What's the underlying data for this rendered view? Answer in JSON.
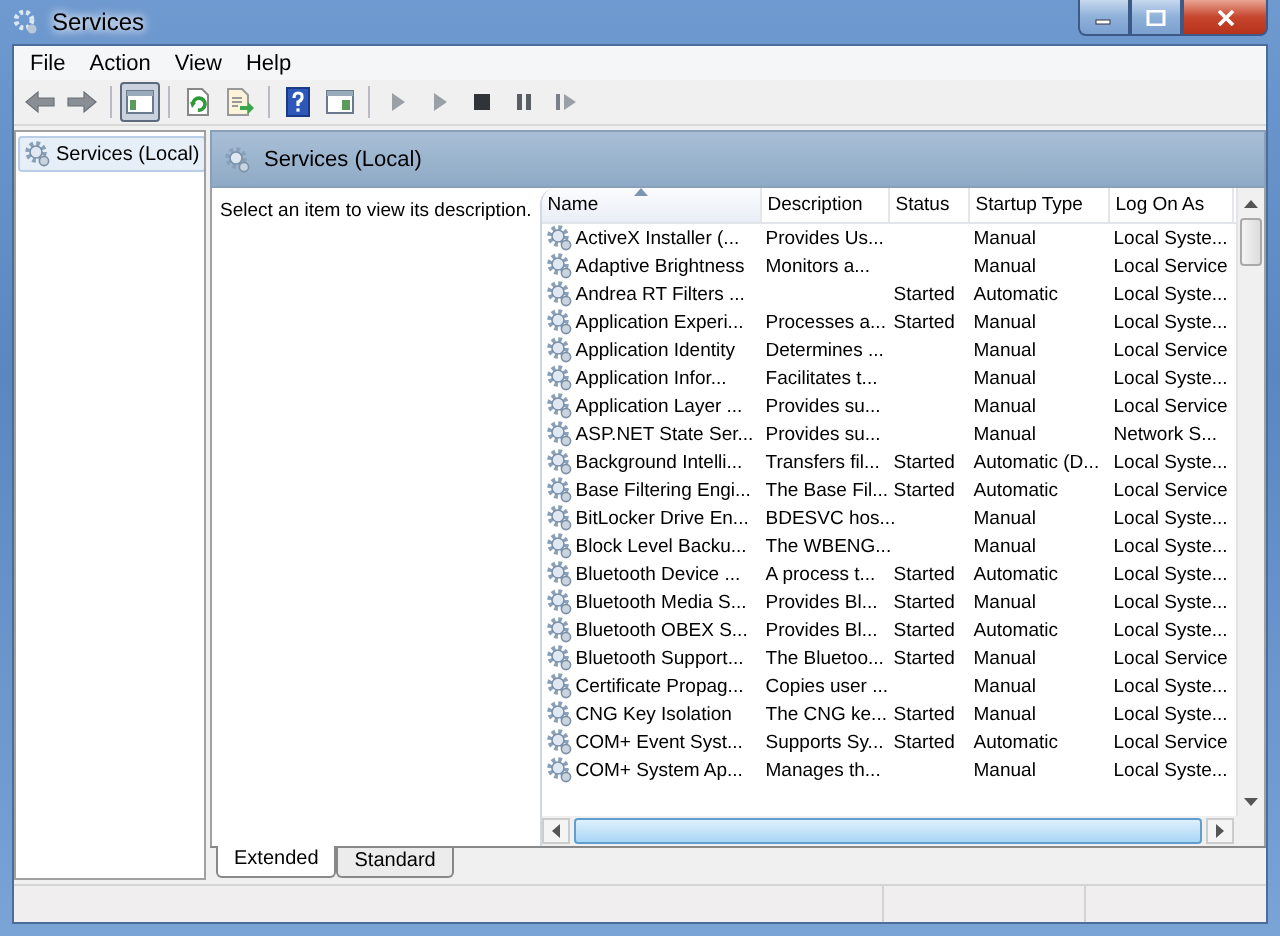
{
  "window": {
    "title": "Services"
  },
  "menu": [
    "File",
    "Action",
    "View",
    "Help"
  ],
  "toolbar": [
    {
      "kind": "back",
      "pressed": false
    },
    {
      "kind": "forward",
      "pressed": false
    },
    {
      "kind": "sep"
    },
    {
      "kind": "tree",
      "pressed": true
    },
    {
      "kind": "sep"
    },
    {
      "kind": "refresh",
      "pressed": false
    },
    {
      "kind": "export",
      "pressed": false
    },
    {
      "kind": "sep"
    },
    {
      "kind": "help",
      "pressed": false
    },
    {
      "kind": "props",
      "pressed": false
    },
    {
      "kind": "sep"
    },
    {
      "kind": "start",
      "pressed": false
    },
    {
      "kind": "start",
      "pressed": false
    },
    {
      "kind": "stop",
      "pressed": false
    },
    {
      "kind": "pause",
      "pressed": false
    },
    {
      "kind": "restart",
      "pressed": false
    }
  ],
  "tree": [
    {
      "label": "Services (Local)",
      "selected": true
    }
  ],
  "panel": {
    "title": "Services (Local)",
    "description": "Select an item to view its description."
  },
  "table": {
    "columns": [
      {
        "label": "Name",
        "sorted": true
      },
      {
        "label": "Description",
        "sorted": false
      },
      {
        "label": "Status",
        "sorted": false
      },
      {
        "label": "Startup Type",
        "sorted": false
      },
      {
        "label": "Log On As",
        "sorted": false
      }
    ],
    "rows": [
      [
        "ActiveX Installer (...",
        "Provides Us...",
        "",
        "Manual",
        "Local Syste..."
      ],
      [
        "Adaptive Brightness",
        "Monitors a...",
        "",
        "Manual",
        "Local Service"
      ],
      [
        "Andrea RT Filters ...",
        "",
        "Started",
        "Automatic",
        "Local Syste..."
      ],
      [
        "Application Experi...",
        "Processes a...",
        "Started",
        "Manual",
        "Local Syste..."
      ],
      [
        "Application Identity",
        "Determines ...",
        "",
        "Manual",
        "Local Service"
      ],
      [
        "Application Infor...",
        "Facilitates t...",
        "",
        "Manual",
        "Local Syste..."
      ],
      [
        "Application Layer ...",
        "Provides su...",
        "",
        "Manual",
        "Local Service"
      ],
      [
        "ASP.NET State Ser...",
        "Provides su...",
        "",
        "Manual",
        "Network S..."
      ],
      [
        "Background Intelli...",
        "Transfers fil...",
        "Started",
        "Automatic (D...",
        "Local Syste..."
      ],
      [
        "Base Filtering Engi...",
        "The Base Fil...",
        "Started",
        "Automatic",
        "Local Service"
      ],
      [
        "BitLocker Drive En...",
        "BDESVC hos...",
        "",
        "Manual",
        "Local Syste..."
      ],
      [
        "Block Level Backu...",
        "The WBENG...",
        "",
        "Manual",
        "Local Syste..."
      ],
      [
        "Bluetooth Device ...",
        "A process t...",
        "Started",
        "Automatic",
        "Local Syste..."
      ],
      [
        "Bluetooth Media S...",
        "Provides Bl...",
        "Started",
        "Manual",
        "Local Syste..."
      ],
      [
        "Bluetooth OBEX S...",
        "Provides Bl...",
        "Started",
        "Automatic",
        "Local Syste..."
      ],
      [
        "Bluetooth Support...",
        "The Bluetoo...",
        "Started",
        "Manual",
        "Local Service"
      ],
      [
        "Certificate Propag...",
        "Copies user ...",
        "",
        "Manual",
        "Local Syste..."
      ],
      [
        "CNG Key Isolation",
        "The CNG ke...",
        "Started",
        "Manual",
        "Local Syste..."
      ],
      [
        "COM+ Event Syst...",
        "Supports Sy...",
        "Started",
        "Automatic",
        "Local Service"
      ],
      [
        "COM+ System Ap...",
        "Manages th...",
        "",
        "Manual",
        "Local Syste..."
      ]
    ]
  },
  "tabs": [
    {
      "label": "Extended",
      "selected": true
    },
    {
      "label": "Standard",
      "selected": false
    }
  ]
}
